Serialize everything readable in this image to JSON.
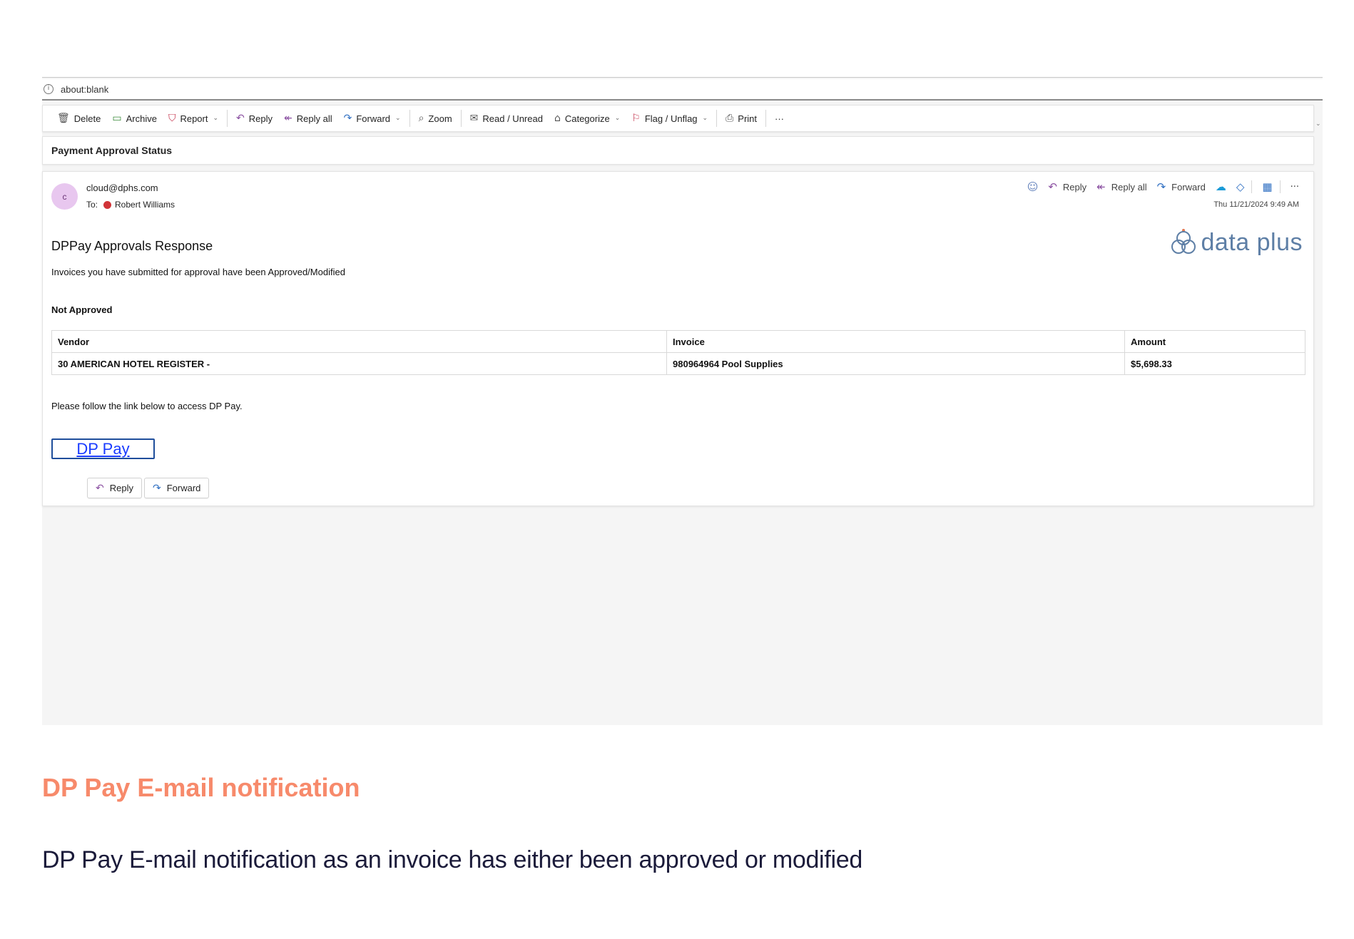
{
  "browser": {
    "address": "about:blank",
    "info_icon": "info-icon"
  },
  "toolbar": {
    "items": [
      {
        "label": "Delete",
        "icon": "trash-icon"
      },
      {
        "label": "Archive",
        "icon": "archive-icon"
      },
      {
        "label": "Report",
        "icon": "shield-icon"
      },
      {
        "label": "Reply",
        "icon": "reply-icon"
      },
      {
        "label": "Reply all",
        "icon": "reply-all-icon"
      },
      {
        "label": "Forward",
        "icon": "forward-icon"
      },
      {
        "label": "Zoom",
        "icon": "zoom-icon"
      },
      {
        "label": "Read / Unread",
        "icon": "envelope-icon"
      },
      {
        "label": "Categorize",
        "icon": "tag-icon"
      },
      {
        "label": "Flag / Unflag",
        "icon": "flag-icon"
      },
      {
        "label": "Print",
        "icon": "printer-icon"
      }
    ],
    "more": "···"
  },
  "subject": "Payment Approval Status",
  "message": {
    "avatar_initial": "c",
    "sender": "cloud@dphs.com",
    "to_label": "To:",
    "recipient": "Robert Williams",
    "actions": {
      "reply": "Reply",
      "reply_all": "Reply all",
      "forward": "Forward",
      "more": "···"
    },
    "timestamp": "Thu 11/21/2024 9:49 AM"
  },
  "body": {
    "title": "DPPay Approvals Response",
    "intro": "Invoices you have submitted for approval have been Approved/Modified",
    "logo_text": "data plus",
    "section": "Not Approved",
    "table": {
      "headers": [
        "Vendor",
        "Invoice",
        "Amount"
      ],
      "rows": [
        [
          "30 AMERICAN HOTEL REGISTER -",
          "980964964 Pool Supplies",
          "$5,698.33"
        ]
      ]
    },
    "follow_text": "Please follow the link below to access DP Pay.",
    "link_label": "DP Pay",
    "bottom_reply": "Reply",
    "bottom_forward": "Forward"
  },
  "caption": {
    "title": "DP Pay E-mail notification",
    "description": "DP Pay E-mail notification as an invoice has either been approved or modified"
  },
  "colors": {
    "accent": "#f78a6b",
    "link": "#1a3cff",
    "logo": "#5e7fa6",
    "avatar_bg": "#e8c7ef",
    "status_dot": "#d13438"
  }
}
